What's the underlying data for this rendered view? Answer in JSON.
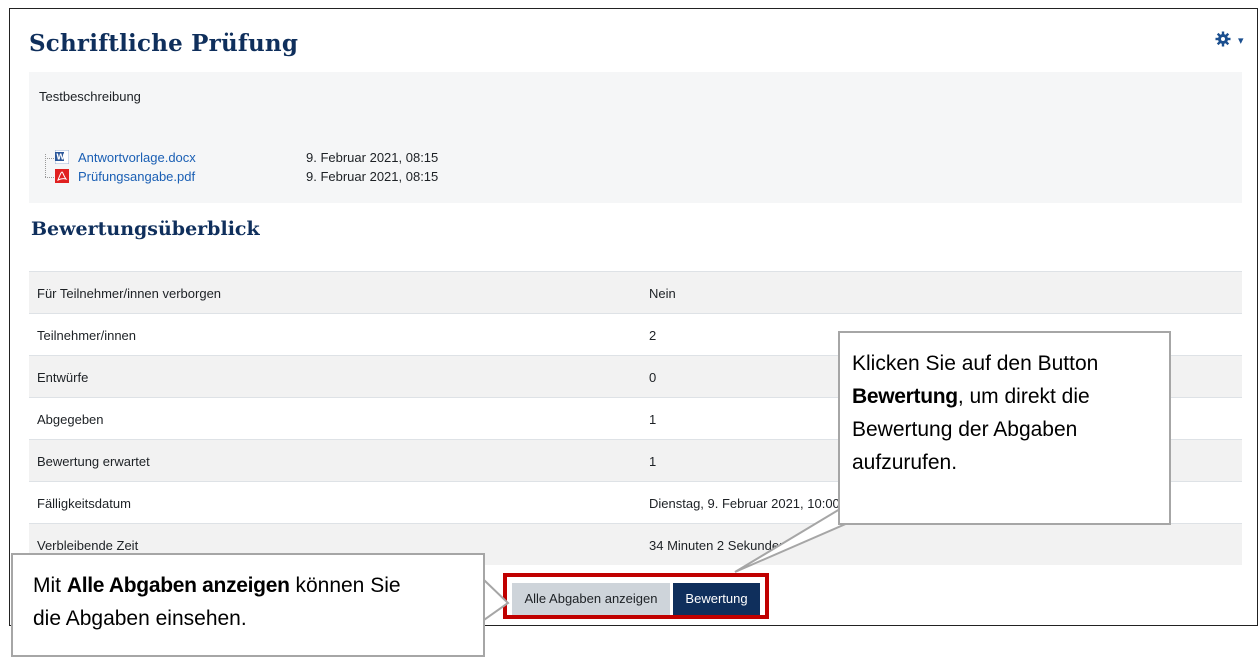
{
  "page": {
    "title": "Schriftliche Prüfung",
    "settings_icon": "gear-icon",
    "description_label": "Testbeschreibung"
  },
  "files": [
    {
      "name": "Antwortvorlage.docx",
      "date": "9. Februar 2021, 08:15",
      "icon": "word-file-icon"
    },
    {
      "name": "Prüfungsangabe.pdf",
      "date": "9. Februar 2021, 08:15",
      "icon": "pdf-file-icon"
    }
  ],
  "grading": {
    "heading": "Bewertungsüberblick",
    "rows": [
      {
        "label": "Für Teilnehmer/innen verborgen",
        "value": "Nein"
      },
      {
        "label": "Teilnehmer/innen",
        "value": "2"
      },
      {
        "label": "Entwürfe",
        "value": "0"
      },
      {
        "label": "Abgegeben",
        "value": "1"
      },
      {
        "label": "Bewertung erwartet",
        "value": "1"
      },
      {
        "label": "Fälligkeitsdatum",
        "value": "Dienstag, 9. Februar 2021, 10:00"
      },
      {
        "label": "Verbleibende Zeit",
        "value": "34 Minuten 2 Sekunden"
      }
    ]
  },
  "buttons": {
    "view_all": "Alle Abgaben anzeigen",
    "grade": "Bewertung"
  },
  "callouts": {
    "right": {
      "line1": "Klicken Sie auf den Button",
      "highlight": "Bewertung",
      "line2": ", um direkt die",
      "line3": "Bewertung der Abgaben",
      "line4": "aufzurufen."
    },
    "left": {
      "prefix": "Mit ",
      "highlight": "Alle Abgaben anzeigen",
      "suffix": " können Sie",
      "line2": "die Abgaben einsehen."
    }
  },
  "colors": {
    "heading": "#0f2f5c",
    "link": "#1a5fb4",
    "primary_button": "#0f2f5c",
    "highlight_border": "#c00000"
  }
}
